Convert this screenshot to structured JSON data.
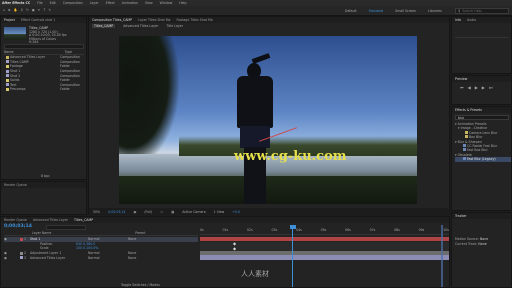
{
  "menubar": {
    "app": "After Effects CC",
    "items": [
      "File",
      "Edit",
      "Composition",
      "Layer",
      "Effect",
      "Animation",
      "View",
      "Window",
      "Help"
    ]
  },
  "workspace": {
    "items": [
      "Default",
      "Standard",
      "Small Screen",
      "Libraries"
    ],
    "active": "Standard",
    "search_placeholder": "Search Help"
  },
  "project": {
    "tab": "Project",
    "effect_controls_tab": "Effect Controls shot 1",
    "comp_info": [
      "Titles_CAMP",
      "1280 x 720 (1.00)",
      "Δ 0:00:10:00, 24.00 fps",
      "Millions of Colors",
      "H.264"
    ],
    "column_name": "Name",
    "column_type": "Type",
    "items": [
      {
        "name": "Advanced Titles Layer",
        "type": "Composition",
        "color": "#c9b460"
      },
      {
        "name": "Titles CAMP",
        "type": "Composition",
        "color": "#a0a0c8"
      },
      {
        "name": "Footage",
        "type": "Folder",
        "color": "#d7c86a"
      },
      {
        "name": "Shot 1",
        "type": "Composition",
        "color": "#a0a0c8"
      },
      {
        "name": "Shot 2",
        "type": "Composition",
        "color": "#a0a0c8"
      },
      {
        "name": "Solids",
        "type": "Folder",
        "color": "#d7c86a"
      },
      {
        "name": "Text",
        "type": "Composition",
        "color": "#a0a0c8"
      },
      {
        "name": "Precomps",
        "type": "Folder",
        "color": "#d7c86a"
      }
    ],
    "footer": "8 bpc"
  },
  "render_queue": {
    "tab": "Render Queue"
  },
  "viewer": {
    "tabs": [
      "Composition Titles_CAMP",
      "Layer Titles Shot Ma",
      "Footage Titles Shot Ma"
    ],
    "flow_tabs": [
      "Titles_CAMP",
      "Advanced Titles Layer",
      "Title Layer"
    ],
    "zoom": "50%",
    "timecode": "0;00;03;14",
    "resolution": "(Full)",
    "camera": "Active Camera",
    "view": "1 View",
    "exposure": "+0.0"
  },
  "watermark": "www.cg-ku.com",
  "right_panels": {
    "info_tab": "Info",
    "audio_tab": "Audio",
    "preview_tab": "Preview",
    "effects_tab": "Effects & Presets",
    "effects_search": "blur",
    "tree": [
      {
        "label": "Animation Presets",
        "indent": 0
      },
      {
        "label": "Image - Creative",
        "indent": 1
      },
      {
        "label": "Camera Lens Blur",
        "indent": 2
      },
      {
        "label": "Box Blur",
        "indent": 2
      },
      {
        "label": "Blur & Sharpen",
        "indent": 0
      },
      {
        "label": "CC Radial Fast Blur",
        "indent": 1
      },
      {
        "label": "Fast Box Blur",
        "indent": 1
      },
      {
        "label": "Obsolete",
        "indent": 0
      },
      {
        "label": "Fast Blur (Legacy)",
        "indent": 1
      }
    ],
    "tracker_tab": "Tracker",
    "tracker": {
      "motion_source": "Motion Source:",
      "source_value": "None",
      "current_track": "Current Track:",
      "track_value": "None"
    }
  },
  "timeline": {
    "tabs": [
      "Render Queue",
      "Advanced Titles Layer",
      "Titles_CAMP"
    ],
    "timecode": "0;00;03;14",
    "column_name": "Layer Name",
    "column_parent": "Parent",
    "layers": [
      {
        "num": "1",
        "name": "Shot 1",
        "mode": "Normal",
        "parent": "None",
        "color": "#c04a4a",
        "selected": true
      },
      {
        "num": "",
        "name": "Position",
        "mode": "",
        "parent": "",
        "color": "",
        "selected": false,
        "value": "640.0,360.0"
      },
      {
        "num": "",
        "name": "Scale",
        "mode": "",
        "parent": "",
        "color": "",
        "selected": false,
        "value": "100.0,100.0%"
      },
      {
        "num": "2",
        "name": "Adjustment Layer 1",
        "mode": "Normal",
        "parent": "None",
        "color": "#8a8a8a",
        "selected": false
      },
      {
        "num": "3",
        "name": "Advanced Titles Layer",
        "mode": "Normal",
        "parent": "None",
        "color": "#a0a0c8",
        "selected": false
      }
    ],
    "ruler": [
      "0s",
      "01s",
      "02s",
      "03s",
      "04s",
      "05s",
      "06s",
      "07s",
      "08s",
      "09s",
      "10s"
    ],
    "toggle": "Toggle Switches / Modes"
  },
  "watermark2": "人人素材"
}
